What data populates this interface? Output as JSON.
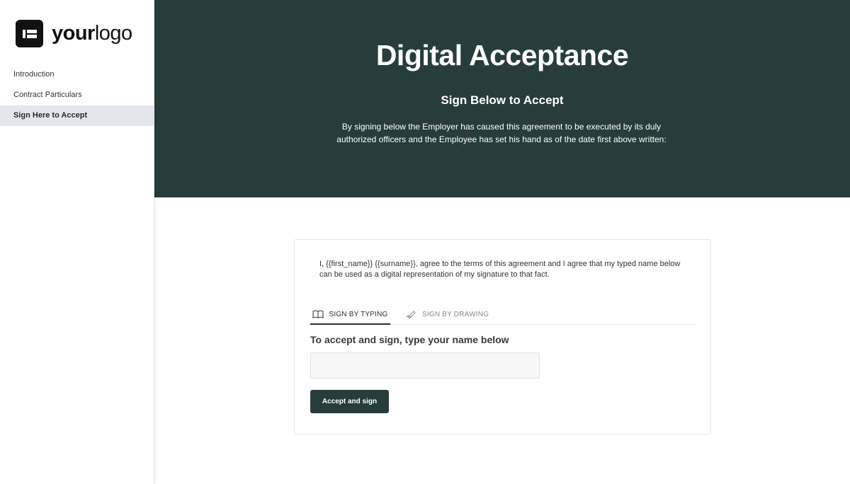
{
  "brand": {
    "logo_bold": "your",
    "logo_light": "logo",
    "dark_color": "#263d3b"
  },
  "sidebar": {
    "items": [
      {
        "label": "Introduction",
        "active": false
      },
      {
        "label": "Contract Particulars",
        "active": false
      },
      {
        "label": "Sign Here to Accept",
        "active": true
      }
    ]
  },
  "header": {
    "title": "Digital Acceptance",
    "subtitle": "Sign Below to Accept",
    "text": "By signing below the Employer has caused this agreement to be executed by its duly authorized officers and the Employee has set his hand as of the date first above written:"
  },
  "sign": {
    "intro": "I, {{first_name}} {{surname}}, agree to the terms of this agreement and I agree that my typed name below can be used as a digital representation of my signature to that fact.",
    "tabs": [
      {
        "label": "SIGN BY TYPING",
        "icon": "keyboard-icon",
        "active": true
      },
      {
        "label": "SIGN BY DRAWING",
        "icon": "pen-icon",
        "active": false
      }
    ],
    "field_label": "To accept and sign, type your name below",
    "input_value": "",
    "input_placeholder": "",
    "button_label": "Accept and sign"
  }
}
